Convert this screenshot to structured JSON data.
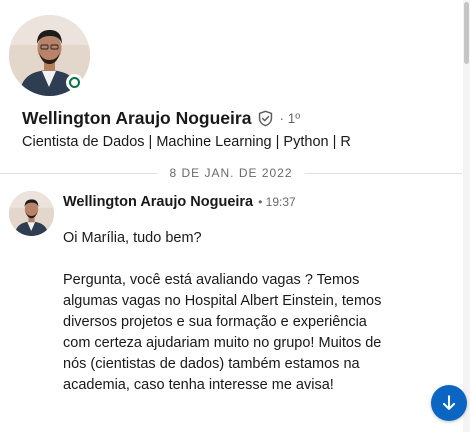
{
  "profile": {
    "name": "Wellington Araujo Nogueira",
    "degree": "· 1º",
    "headline": "Cientista de Dados | Machine Learning | Python | R",
    "presence": "online",
    "avatar_icon": "person-photo",
    "verified_icon": "shield-check-icon"
  },
  "divider": {
    "date": "8 DE JAN. DE 2022"
  },
  "message": {
    "sender": "Wellington Araujo Nogueira",
    "time": "• 19:37",
    "paragraphs": [
      "Oi Marília, tudo bem?",
      "Pergunta, você está avaliando vagas ? Temos algumas vagas no Hospital Albert Einstein, temos diversos projetos e sua formação e experiência com certeza ajudariam muito no grupo! Muitos de nós (cientistas de dados) também estamos na academia, caso tenha interesse me avisa!"
    ]
  },
  "jump_button": {
    "icon": "arrow-down-icon"
  },
  "colors": {
    "accent": "#0a66c2",
    "online": "#057642",
    "text_primary": "#1f1f1f",
    "text_secondary": "#666666"
  }
}
